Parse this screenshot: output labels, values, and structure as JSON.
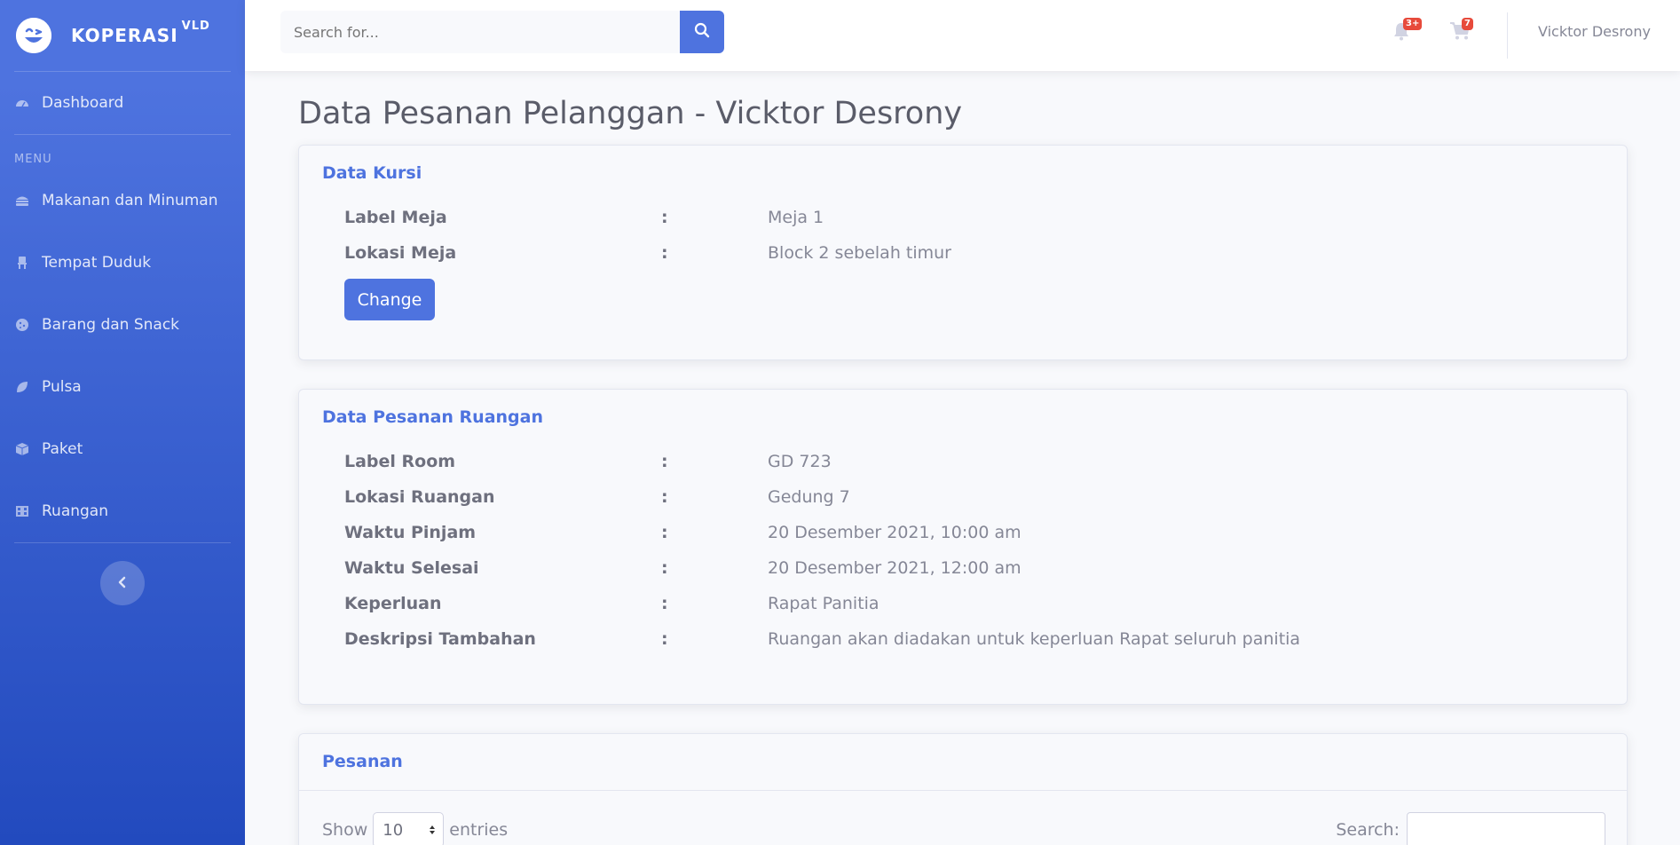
{
  "brand": {
    "name": "KOPERASI",
    "sup": "VLD"
  },
  "sidebar": {
    "dashboard": "Dashboard",
    "heading": "MENU",
    "items": [
      {
        "label": "Makanan dan Minuman",
        "icon": "hamburger-icon"
      },
      {
        "label": "Tempat Duduk",
        "icon": "chair-icon"
      },
      {
        "label": "Barang dan Snack",
        "icon": "cookie-icon"
      },
      {
        "label": "Pulsa",
        "icon": "leaf-icon"
      },
      {
        "label": "Paket",
        "icon": "box-icon"
      },
      {
        "label": "Ruangan",
        "icon": "building-icon"
      }
    ]
  },
  "topbar": {
    "search_placeholder": "Search for...",
    "alerts_badge": "3+",
    "cart_badge": "7",
    "user_name": "Vicktor Desrony"
  },
  "page": {
    "title": "Data Pesanan Pelanggan - Vicktor Desrony"
  },
  "kursi": {
    "title": "Data Kursi",
    "rows": [
      {
        "label": "Label Meja",
        "sep": ":",
        "value": "Meja 1"
      },
      {
        "label": "Lokasi Meja",
        "sep": ":",
        "value": "Block 2 sebelah timur"
      }
    ],
    "button": "Change"
  },
  "ruangan": {
    "title": "Data Pesanan Ruangan",
    "rows": [
      {
        "label": "Label Room",
        "sep": ":",
        "value": "GD 723"
      },
      {
        "label": "Lokasi Ruangan",
        "sep": ":",
        "value": "Gedung 7"
      },
      {
        "label": "Waktu Pinjam",
        "sep": ":",
        "value": "20 Desember 2021, 10:00 am"
      },
      {
        "label": "Waktu Selesai",
        "sep": ":",
        "value": "20 Desember 2021, 12:00 am"
      },
      {
        "label": "Keperluan",
        "sep": ":",
        "value": "Rapat Panitia"
      },
      {
        "label": "Deskripsi Tambahan",
        "sep": ":",
        "value": "Ruangan akan diadakan untuk keperluan Rapat seluruh panitia"
      }
    ]
  },
  "pesanan": {
    "title": "Pesanan",
    "show_label": "Show",
    "entries_value": "10",
    "entries_label": "entries",
    "search_label": "Search:"
  }
}
